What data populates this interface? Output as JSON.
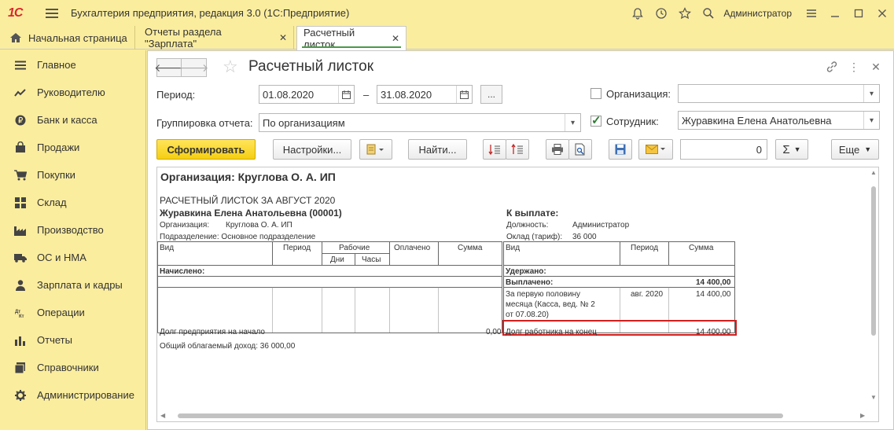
{
  "app": {
    "logo": "1С",
    "title": "Бухгалтерия предприятия, редакция 3.0  (1С:Предприятие)",
    "user": "Администратор"
  },
  "tabs": [
    {
      "label": "Начальная страница"
    },
    {
      "label": "Отчеты раздела \"Зарплата\""
    },
    {
      "label": "Расчетный листок"
    }
  ],
  "sidebar": {
    "items": [
      {
        "label": "Главное",
        "icon": "menu-lines-icon"
      },
      {
        "label": "Руководителю",
        "icon": "trend-chart-icon"
      },
      {
        "label": "Банк и касса",
        "icon": "ruble-coin-icon"
      },
      {
        "label": "Продажи",
        "icon": "shopping-bag-icon"
      },
      {
        "label": "Покупки",
        "icon": "shopping-cart-icon"
      },
      {
        "label": "Склад",
        "icon": "warehouse-grid-icon"
      },
      {
        "label": "Производство",
        "icon": "factory-icon"
      },
      {
        "label": "ОС и НМА",
        "icon": "truck-icon"
      },
      {
        "label": "Зарплата и кадры",
        "icon": "person-icon"
      },
      {
        "label": "Операции",
        "icon": "debit-credit-icon"
      },
      {
        "label": "Отчеты",
        "icon": "bar-chart-icon"
      },
      {
        "label": "Справочники",
        "icon": "books-icon"
      },
      {
        "label": "Администрирование",
        "icon": "gear-icon"
      }
    ]
  },
  "form": {
    "title": "Расчетный листок",
    "period_label": "Период:",
    "date_from": "01.08.2020",
    "date_sep": "–",
    "date_to": "31.08.2020",
    "period_more": "...",
    "grouping_label": "Группировка отчета:",
    "grouping_value": "По организациям",
    "org_label": "Организация:",
    "org_checked": false,
    "org_value": "",
    "employee_label": "Сотрудник:",
    "employee_checked": true,
    "employee_value": "Журавкина Елена Анатольевна"
  },
  "toolbar": {
    "generate": "Сформировать",
    "settings": "Настройки...",
    "find": "Найти...",
    "sum_value": "0",
    "sigma": "Σ",
    "more": "Еще"
  },
  "report": {
    "org_header": "Организация: Круглова О. А. ИП",
    "title": "РАСЧЕТНЫЙ ЛИСТОК ЗА АВГУСТ 2020",
    "employee": "Журавкина Елена Анатольевна (00001)",
    "org_key": "Организация:",
    "org_val": "Круглова О. А. ИП",
    "dept": "Подразделение: Основное подразделение",
    "to_pay": "К выплате:",
    "position_key": "Должность:",
    "position_val": "Администратор",
    "salary_key": "Оклад (тариф):",
    "salary_val": "36 000",
    "left_headers": {
      "vid": "Вид",
      "period": "Период",
      "working": "Рабочие",
      "days": "Дни",
      "hours": "Часы",
      "paid": "Оплачено",
      "sum": "Сумма"
    },
    "right_headers": {
      "vid": "Вид",
      "period": "Период",
      "sum": "Сумма"
    },
    "accrued": "Начислено:",
    "withheld": "Удержано:",
    "paid_out": "Выплачено:",
    "paid_out_sum": "14 400,00",
    "pay_row_text_1": "За первую половину",
    "pay_row_text_2": "месяца (Касса, вед. № 2",
    "pay_row_text_3": "от 07.08.20)",
    "pay_row_period": "авг. 2020",
    "pay_row_sum": "14 400,00",
    "debt_start": "Долг предприятия на начало",
    "debt_start_sum": "0,00",
    "debt_end": "Долг работника на конец",
    "debt_end_sum": "14 400,00",
    "taxable": "Общий облагаемый доход: 36 000,00"
  }
}
